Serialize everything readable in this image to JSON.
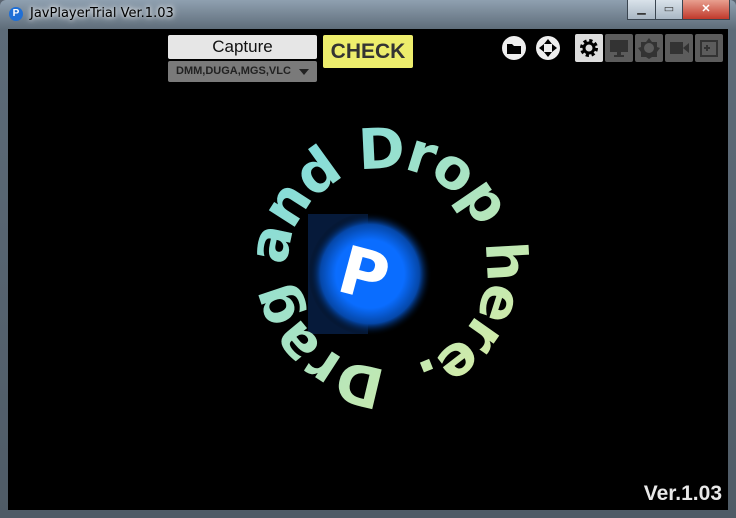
{
  "window": {
    "title": "JavPlayerTrial Ver.1.03",
    "app_icon": "P"
  },
  "toolbar": {
    "capture_label": "Capture",
    "source_select": "DMM,DUGA,MGS,VLC",
    "check_label": "CHECK",
    "icons": [
      "folder-icon",
      "gamepad-icon",
      "gear-icon",
      "monitor-icon",
      "brightness-icon",
      "camera-icon",
      "add-image-icon"
    ]
  },
  "main": {
    "drop_text": "Drag and Drop here.",
    "version": "Ver.1.03"
  },
  "colors": {
    "check": "#eded6c",
    "logo": "#0a6dff",
    "text_gradient_start": "#7be0e0",
    "text_gradient_end": "#e6f2a0"
  }
}
